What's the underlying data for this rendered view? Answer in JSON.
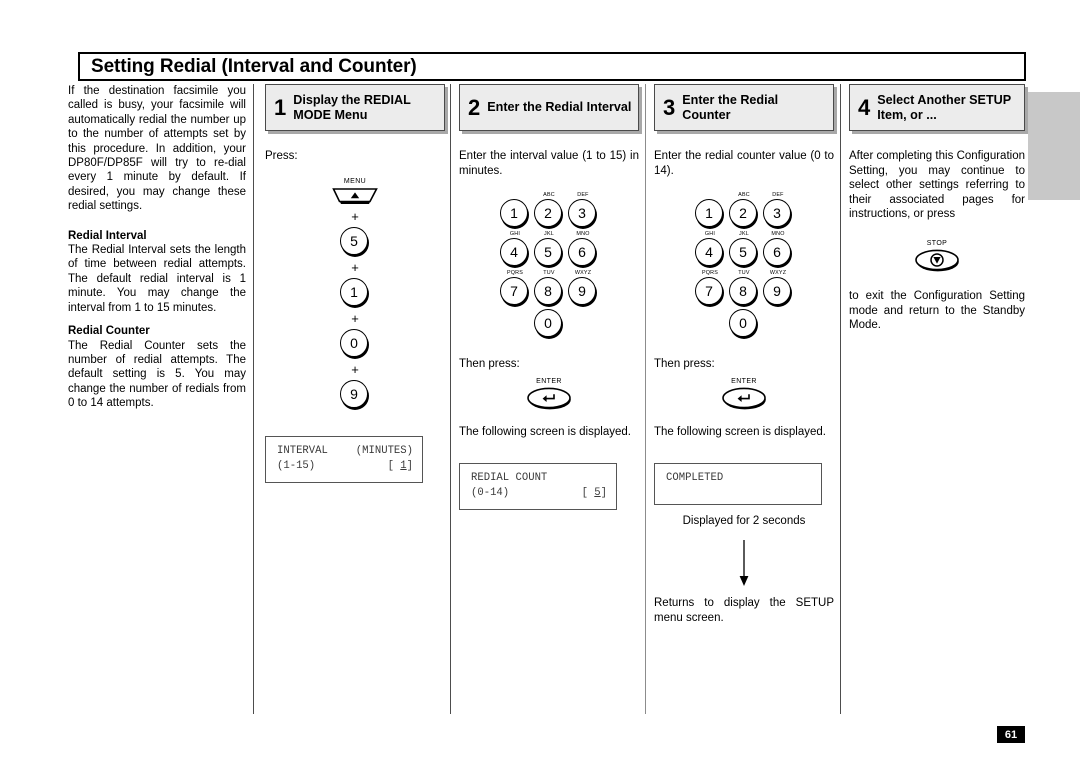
{
  "page": {
    "title": "Setting Redial (Interval and Counter)",
    "number": "61"
  },
  "intro": {
    "paragraph1": "If the destination facsimile you called is busy, your facsimile will automatically redial the number up to the number of attempts set by this procedure.  In addition, your DP80F/DP85F will try to re-dial every 1 minute by default. If desired, you may change these redial settings.",
    "heading1": "Redial Interval",
    "paragraph2": "The Redial Interval sets the length of time between redial attempts. The default redial interval is 1 minute. You may change the interval from 1 to 15 minutes.",
    "heading2": "Redial Counter",
    "paragraph3": "The Redial Counter sets the number of redial attempts. The default setting is 5. You may change the number of redials from 0 to 14 attempts."
  },
  "step1": {
    "number": "1",
    "label": "Display the REDIAL MODE Menu",
    "press_label": "Press:",
    "menu_key": "MENU",
    "plus": "+",
    "keys": [
      "5",
      "1",
      "0",
      "9"
    ],
    "lcd": {
      "line1_left": "INTERVAL",
      "line1_right": "(MINUTES)",
      "line2_left": "(1-15)",
      "line2_bracket_open": "[ ",
      "line2_value": "1",
      "line2_bracket_close": "]"
    }
  },
  "step2": {
    "number": "2",
    "label": "Enter the Redial Interval",
    "instruction": "Enter the interval value (1 to 15) in minutes.",
    "then_press": "Then press:",
    "enter_key": "ENTER",
    "result_text": "The following screen is displayed.",
    "keypad": [
      {
        "digit": "1",
        "letters": ""
      },
      {
        "digit": "2",
        "letters": "ABC"
      },
      {
        "digit": "3",
        "letters": "DEF"
      },
      {
        "digit": "4",
        "letters": "GHI"
      },
      {
        "digit": "5",
        "letters": "JKL"
      },
      {
        "digit": "6",
        "letters": "MNO"
      },
      {
        "digit": "7",
        "letters": "PQRS"
      },
      {
        "digit": "8",
        "letters": "TUV"
      },
      {
        "digit": "9",
        "letters": "WXYZ"
      }
    ],
    "keypad_zero": "0",
    "lcd": {
      "line1_left": "REDIAL COUNT",
      "line2_left": "(0-14)",
      "line2_bracket_open": "[ ",
      "line2_value": "5",
      "line2_bracket_close": "]"
    }
  },
  "step3": {
    "number": "3",
    "label": "Enter the Redial Counter",
    "instruction": "Enter the redial counter value (0 to 14).",
    "then_press": "Then press:",
    "enter_key": "ENTER",
    "result_text": "The following screen is displayed.",
    "keypad": [
      {
        "digit": "1",
        "letters": ""
      },
      {
        "digit": "2",
        "letters": "ABC"
      },
      {
        "digit": "3",
        "letters": "DEF"
      },
      {
        "digit": "4",
        "letters": "GHI"
      },
      {
        "digit": "5",
        "letters": "JKL"
      },
      {
        "digit": "6",
        "letters": "MNO"
      },
      {
        "digit": "7",
        "letters": "PQRS"
      },
      {
        "digit": "8",
        "letters": "TUV"
      },
      {
        "digit": "9",
        "letters": "WXYZ"
      }
    ],
    "keypad_zero": "0",
    "lcd": {
      "line1_left": "COMPLETED"
    },
    "caption": "Displayed for 2 seconds",
    "return_text": "Returns to display the SETUP menu screen."
  },
  "step4": {
    "number": "4",
    "label": "Select Another SETUP Item, or ...",
    "paragraph1": "After completing this Configuration Setting, you may continue to select other settings referring to their associated pages for instructions, or press",
    "stop_key": "STOP",
    "paragraph2": "to exit the Configuration Setting mode and return to the Standby Mode."
  }
}
